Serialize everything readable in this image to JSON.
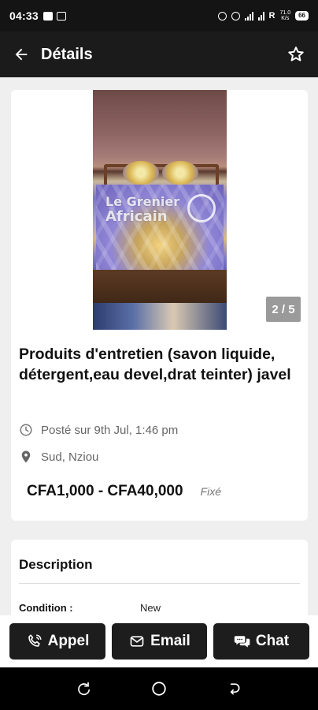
{
  "status_bar": {
    "time": "04:33",
    "carrier_letter": "R",
    "speed_top": "71.0",
    "speed_bottom": "K/s",
    "battery": "66"
  },
  "app_bar": {
    "title": "Détails",
    "back_icon": "arrow-left-icon",
    "favorite_icon": "star-outline-icon"
  },
  "listing": {
    "watermark_line1": "Le Grenier",
    "watermark_line2": "Africain",
    "photo_counter": "2 / 5",
    "title": "Produits d'entretien (savon liquide, détergent,eau devel,drat teinter) javel",
    "posted": "Posté sur 9th Jul, 1:46 pm",
    "location": "Sud, Nziou",
    "price": "CFA1,000 - CFA40,000",
    "price_type": "Fixé"
  },
  "description": {
    "heading": "Description",
    "condition_label": "Condition :",
    "condition_value": "New"
  },
  "actions": {
    "call_label": "Appel",
    "email_label": "Email",
    "chat_label": "Chat"
  },
  "colors": {
    "app_bar_bg": "#1b1b1b",
    "button_bg": "#1d1d1d",
    "page_bg": "#efefef"
  }
}
